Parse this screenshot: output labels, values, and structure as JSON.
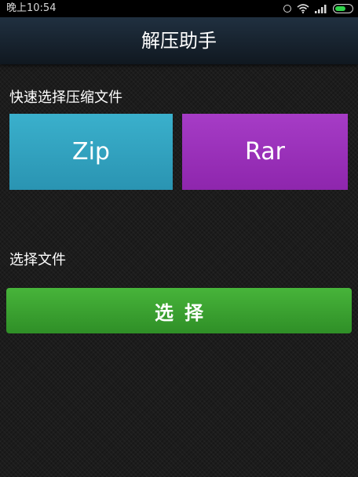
{
  "status_bar": {
    "time": "晚上10:54",
    "battery_level": 0.65,
    "icons": [
      "sync-icon",
      "wifi-icon",
      "signal-icon",
      "battery-icon"
    ]
  },
  "header": {
    "title": "解压助手"
  },
  "quick_select": {
    "label": "快速选择压缩文件",
    "zip_label": "Zip",
    "rar_label": "Rar"
  },
  "file_select": {
    "label": "选择文件",
    "button_label": "选择"
  },
  "colors": {
    "zip_tile": "#2a9fbf",
    "rar_tile": "#9a2fb9",
    "select_button": "#36a02e",
    "title_bar": "#18242f",
    "battery": "#2fd44a"
  }
}
